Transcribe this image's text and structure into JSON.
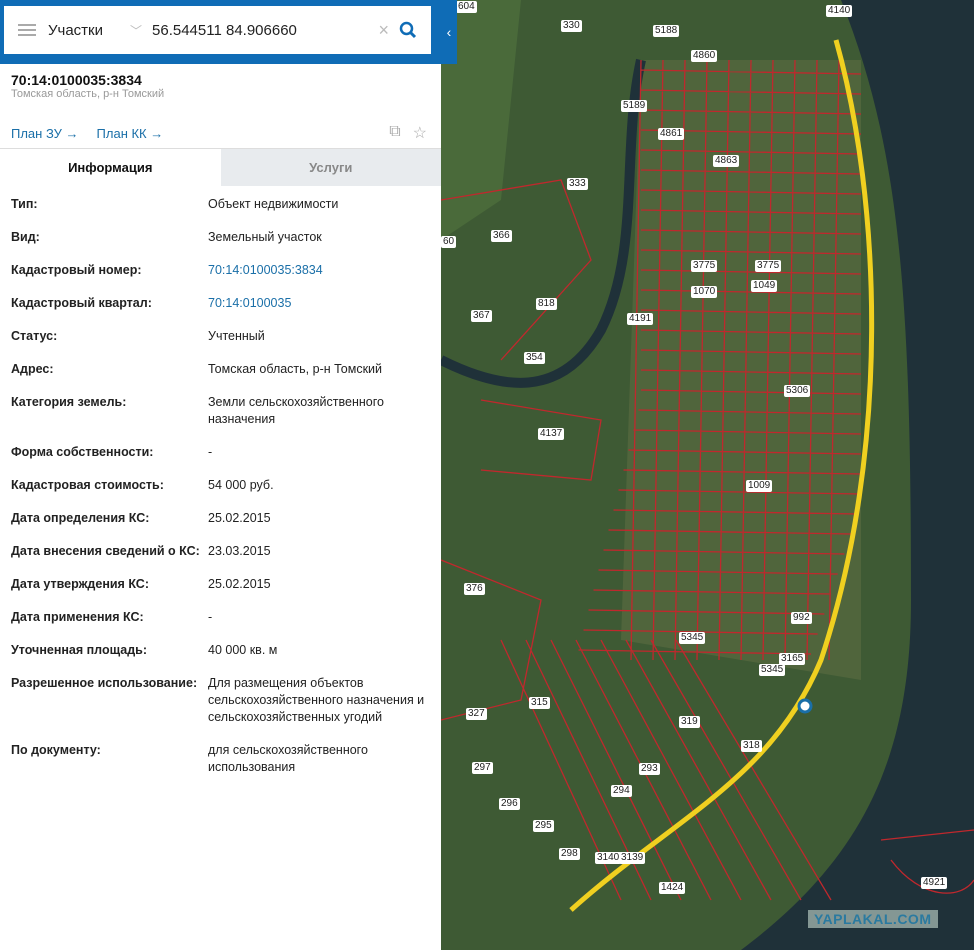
{
  "search": {
    "layer": "Участки",
    "query": "56.544511 84.906660"
  },
  "object": {
    "cadastral_number": "70:14:0100035:3834",
    "region": "Томская область, р-н Томский"
  },
  "links": {
    "plan_zu": "План ЗУ →",
    "plan_kk": "План КК →"
  },
  "tabs": [
    {
      "label": "Информация",
      "active": true
    },
    {
      "label": "Услуги",
      "active": false
    }
  ],
  "info": [
    {
      "key": "Тип:",
      "value": "Объект недвижимости"
    },
    {
      "key": "Вид:",
      "value": "Земельный участок"
    },
    {
      "key": "Кадастровый номер:",
      "value": "70:14:0100035:3834",
      "link": true
    },
    {
      "key": "Кадастровый квартал:",
      "value": "70:14:0100035",
      "link": true
    },
    {
      "key": "Статус:",
      "value": "Учтенный"
    },
    {
      "key": "Адрес:",
      "value": "Томская область, р-н Томский"
    },
    {
      "key": "Категория земель:",
      "value": "Земли сельскохозяйственного назначения"
    },
    {
      "key": "Форма собственности:",
      "value": "-"
    },
    {
      "key": "Кадастровая стоимость:",
      "value": "54 000 руб."
    },
    {
      "key": "Дата определения КС:",
      "value": "25.02.2015"
    },
    {
      "key": "Дата внесения сведений о КС:",
      "value": "23.03.2015"
    },
    {
      "key": "Дата утверждения КС:",
      "value": "25.02.2015"
    },
    {
      "key": "Дата применения КС:",
      "value": "-"
    },
    {
      "key": "Уточненная площадь:",
      "value": "40 000 кв. м"
    },
    {
      "key": "Разрешенное использование:",
      "value": "Для размещения объектов сельскохозяйственного назначения и сельскохозяйственных угодий"
    },
    {
      "key": "По документу:",
      "value": "для сельскохозяйственного использования"
    }
  ],
  "map": {
    "parcel_labels": [
      "330",
      "5188",
      "4860",
      "5189",
      "4861",
      "4863",
      "333",
      "366",
      "3775",
      "3775",
      "1070",
      "1049",
      "818",
      "367",
      "4191",
      "354",
      "5306",
      "4137",
      "1009",
      "376",
      "992",
      "5345",
      "3165",
      "5345",
      "315",
      "327",
      "319",
      "318",
      "297",
      "293",
      "294",
      "296",
      "295",
      "298",
      "3140",
      "3139",
      "1424",
      "4921",
      "60",
      "604",
      "4140"
    ],
    "watermark": "YAPLAKAL.COM",
    "colors": {
      "parcel": "#c0282d",
      "road": "#f0d020",
      "water": "#1e3038"
    }
  }
}
